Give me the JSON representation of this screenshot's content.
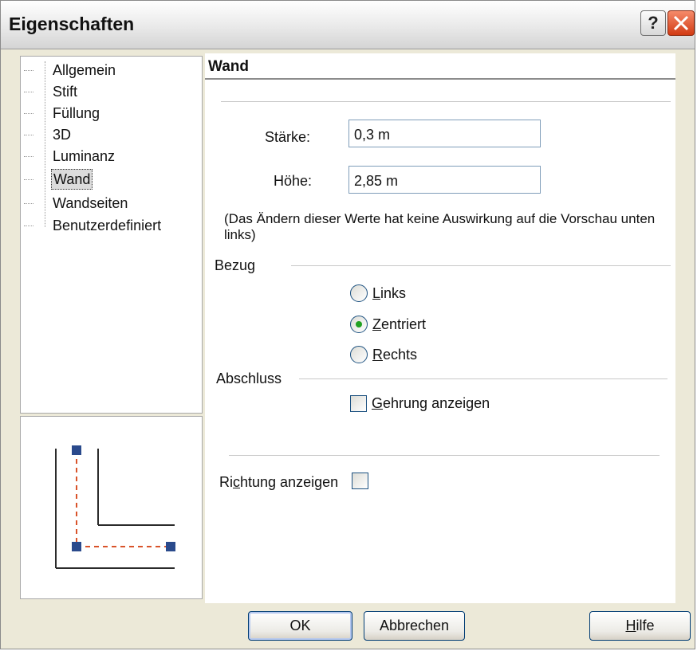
{
  "window": {
    "title": "Eigenschaften",
    "help_glyph": "?",
    "close_glyph": "×"
  },
  "tree": {
    "items": [
      {
        "label": "Allgemein",
        "selected": false
      },
      {
        "label": "Stift",
        "selected": false
      },
      {
        "label": "Füllung",
        "selected": false
      },
      {
        "label": "3D",
        "selected": false
      },
      {
        "label": "Luminanz",
        "selected": false
      },
      {
        "label": "Wand",
        "selected": true
      },
      {
        "label": "Wandseiten",
        "selected": false
      },
      {
        "label": "Benutzerdefiniert",
        "selected": false
      }
    ]
  },
  "section": {
    "title": "Wand",
    "staerke_label": "Stärke:",
    "staerke_value": "0,3 m",
    "hoehe_label": "Höhe:",
    "hoehe_value": "2,85 m",
    "note": "(Das Ändern dieser Werte hat keine Auswirkung auf die Vorschau unten links)",
    "bezug_label": "Bezug",
    "radio_links": "Links",
    "radio_links_rest": "inks",
    "radio_zentriert_rest": "entriert",
    "radio_rechts_rest": "echts",
    "radio_links_access": "L",
    "radio_zentriert_access": "Z",
    "radio_rechts_access": "R",
    "selected_bezug": "Zentriert",
    "abschluss_label": "Abschluss",
    "gehrung_access": "G",
    "gehrung_rest": "ehrung anzeigen",
    "gehrung_checked": false,
    "richtung_pre": "Ri",
    "richtung_access": "c",
    "richtung_rest": "htung anzeigen",
    "richtung_checked": false
  },
  "buttons": {
    "ok": "OK",
    "cancel": "Abbrechen",
    "help_access": "H",
    "help_rest": "ilfe"
  },
  "colors": {
    "preview_line": "#2b2b2b",
    "preview_dashed": "#d9532a",
    "preview_handle": "#2a4a8c",
    "radio_selected": "#21a121"
  }
}
